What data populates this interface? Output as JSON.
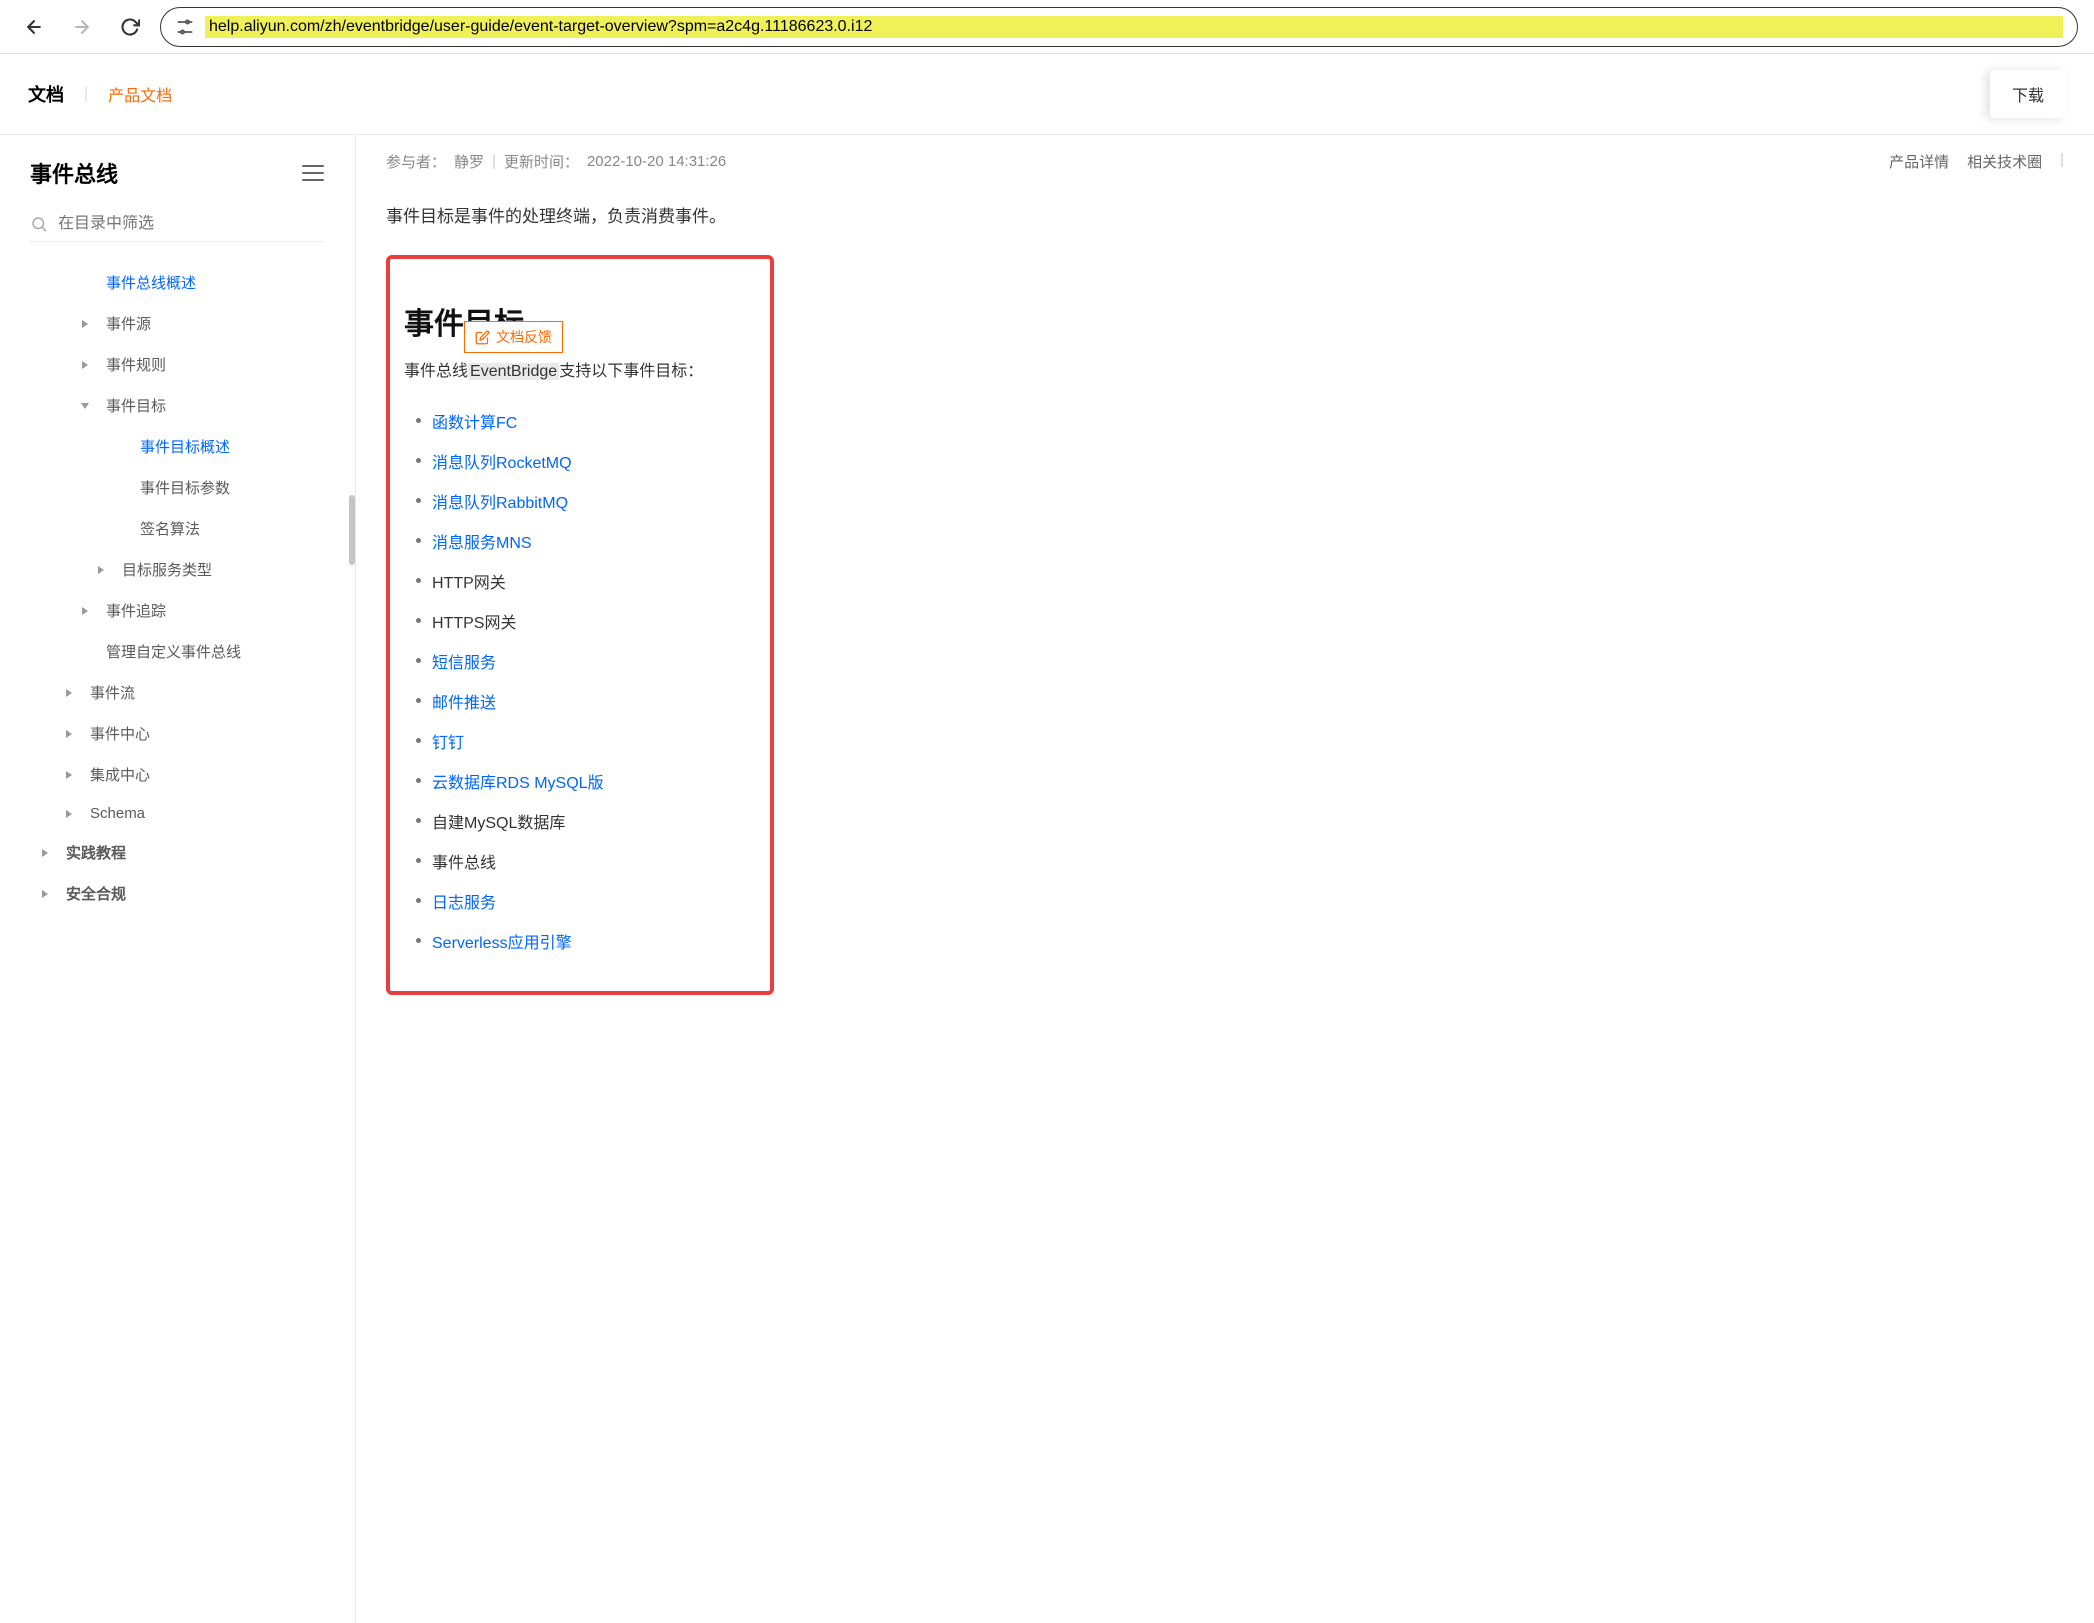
{
  "browser": {
    "url": "help.aliyun.com/zh/eventbridge/user-guide/event-target-overview?spm=a2c4g.11186623.0.i12"
  },
  "header": {
    "docs": "文档",
    "product": "产品文档",
    "download": "下载"
  },
  "sidebar": {
    "title": "事件总线",
    "search_placeholder": "在目录中筛选",
    "items": [
      {
        "label": "事件总线概述",
        "level": 2,
        "caret": "none",
        "active": true
      },
      {
        "label": "事件源",
        "level": 2,
        "caret": "right",
        "active": false
      },
      {
        "label": "事件规则",
        "level": 2,
        "caret": "right",
        "active": false
      },
      {
        "label": "事件目标",
        "level": 2,
        "caret": "down",
        "active": false
      },
      {
        "label": "事件目标概述",
        "level": 3,
        "caret": "none",
        "active": true
      },
      {
        "label": "事件目标参数",
        "level": 3,
        "caret": "none",
        "active": false
      },
      {
        "label": "签名算法",
        "level": 3,
        "caret": "none",
        "active": false
      },
      {
        "label": "目标服务类型",
        "level": 4,
        "caret": "right",
        "active": false
      },
      {
        "label": "事件追踪",
        "level": 2,
        "caret": "right",
        "active": false
      },
      {
        "label": "管理自定义事件总线",
        "level": 2,
        "caret": "none",
        "active": false
      },
      {
        "label": "事件流",
        "level": 1,
        "caret": "right",
        "active": false
      },
      {
        "label": "事件中心",
        "level": 1,
        "caret": "right",
        "active": false
      },
      {
        "label": "集成中心",
        "level": 1,
        "caret": "right",
        "active": false
      },
      {
        "label": "Schema",
        "level": 1,
        "caret": "right",
        "active": false
      },
      {
        "label": "实践教程",
        "level": 0,
        "caret": "right",
        "active": false
      },
      {
        "label": "安全合规",
        "level": 0,
        "caret": "right",
        "active": false
      }
    ]
  },
  "meta": {
    "contributor_label": "参与者：",
    "contributor": "静罗",
    "updated_label": "更新时间：",
    "updated": "2022-10-20 14:31:26",
    "product_details": "产品详情",
    "related": "相关技术圈"
  },
  "content": {
    "intro": "事件目标是事件的处理终端，负责消费事件。",
    "section_title": "事件目标",
    "feedback": "文档反馈",
    "support_prefix": "事件总线",
    "support_highlight": "EventBridge",
    "support_suffix": "支持以下事件目标：",
    "targets": [
      {
        "label": "函数计算FC",
        "linked": true
      },
      {
        "label": "消息队列RocketMQ",
        "linked": true
      },
      {
        "label": "消息队列RabbitMQ",
        "linked": true
      },
      {
        "label": "消息服务MNS",
        "linked": true
      },
      {
        "label": "HTTP网关",
        "linked": false
      },
      {
        "label": "HTTPS网关",
        "linked": false
      },
      {
        "label": "短信服务",
        "linked": true
      },
      {
        "label": "邮件推送",
        "linked": true
      },
      {
        "label": "钉钉",
        "linked": true
      },
      {
        "label": "云数据库RDS MySQL版",
        "linked": true
      },
      {
        "label": "自建MySQL数据库",
        "linked": false
      },
      {
        "label": "事件总线",
        "linked": false
      },
      {
        "label": "日志服务",
        "linked": true
      },
      {
        "label": "Serverless应用引擎",
        "linked": true
      }
    ]
  }
}
